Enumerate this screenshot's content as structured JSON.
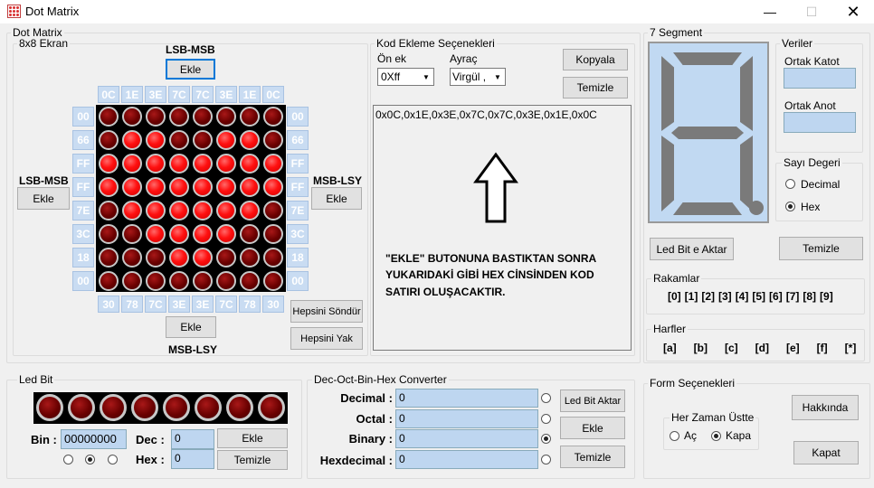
{
  "window": {
    "title": "Dot Matrix"
  },
  "dotmatrix": {
    "group_title": "Dot Matrix",
    "screen_title": "8x8 Ekran",
    "top_label": "LSB-MSB",
    "top_button": "Ekle",
    "left_label": "LSB-MSB",
    "left_button": "Ekle",
    "right_label": "MSB-LSY",
    "right_button": "Ekle",
    "bottom_button": "Ekle",
    "bottom_label": "MSB-LSY",
    "top_codes": [
      "0C",
      "1E",
      "3E",
      "7C",
      "7C",
      "3E",
      "1E",
      "0C"
    ],
    "left_codes": [
      "00",
      "66",
      "FF",
      "FF",
      "7E",
      "3C",
      "18",
      "00"
    ],
    "right_codes": [
      "00",
      "66",
      "FF",
      "FF",
      "7E",
      "3C",
      "18",
      "00"
    ],
    "bottom_codes": [
      "30",
      "78",
      "7C",
      "3E",
      "3E",
      "7C",
      "78",
      "30"
    ],
    "rows": [
      [
        0,
        0,
        0,
        0,
        0,
        0,
        0,
        0
      ],
      [
        0,
        1,
        1,
        0,
        0,
        1,
        1,
        0
      ],
      [
        1,
        1,
        1,
        1,
        1,
        1,
        1,
        1
      ],
      [
        1,
        1,
        1,
        1,
        1,
        1,
        1,
        1
      ],
      [
        0,
        1,
        1,
        1,
        1,
        1,
        1,
        0
      ],
      [
        0,
        0,
        1,
        1,
        1,
        1,
        0,
        0
      ],
      [
        0,
        0,
        0,
        1,
        1,
        0,
        0,
        0
      ],
      [
        0,
        0,
        0,
        0,
        0,
        0,
        0,
        0
      ]
    ],
    "btn_off_all": "Hepsini Söndür",
    "btn_on_all": "Hepsini Yak"
  },
  "code": {
    "group_title": "Kod Ekleme Seçenekleri",
    "prefix_label": "Ön ek",
    "prefix_value": "0Xff",
    "sep_label": "Ayraç",
    "sep_value": "Virgül ,",
    "copy_button": "Kopyala",
    "clear_button": "Temizle",
    "output": "0x0C,0x1E,0x3E,0x7C,0x7C,0x3E,0x1E,0x0C",
    "note_line1": "\"EKLE\" BUTONUNA BASTIKTAN SONRA",
    "note_line2": "YUKARIDAKİ GİBİ HEX CİNSİNDEN KOD",
    "note_line3": "SATIRI OLUŞACAKTIR."
  },
  "segment": {
    "group_title": "7 Segment",
    "data_title": "Veriler",
    "common_cathode": "Ortak Katot",
    "common_anode": "Ortak Anot",
    "value_title": "Sayı Degeri",
    "decimal": "Decimal",
    "hex": "Hex",
    "send_button": "Led Bit e Aktar",
    "clear_button": "Temizle",
    "digits_title": "Rakamlar",
    "digits": [
      "[0]",
      "[1]",
      "[2]",
      "[3]",
      "[4]",
      "[5]",
      "[6]",
      "[7]",
      "[8]",
      "[9]"
    ],
    "letters_title": "Harfler",
    "letters": [
      "[a]",
      "[b]",
      "[c]",
      "[d]",
      "[e]",
      "[f]",
      "[*]"
    ]
  },
  "ledbit": {
    "group_title": "Led Bit",
    "bin_label": "Bin :",
    "bin_value": "00000000",
    "dec_label": "Dec :",
    "dec_value": "0",
    "hex_label": "Hex :",
    "hex_value": "0",
    "add_button": "Ekle",
    "clear_button": "Temizle"
  },
  "converter": {
    "group_title": "Dec-Oct-Bin-Hex Converter",
    "decimal_label": "Decimal :",
    "decimal_value": "0",
    "octal_label": "Octal :",
    "octal_value": "0",
    "binary_label": "Binary :",
    "binary_value": "0",
    "hex_label": "Hexdecimal :",
    "hex_value": "0",
    "send_button": "Led Bit Aktar",
    "add_button": "Ekle",
    "clear_button": "Temizle"
  },
  "form": {
    "group_title": "Form Seçenekleri",
    "topmost_title": "Her Zaman Üstte",
    "on_label": "Aç",
    "off_label": "Kapa",
    "about_button": "Hakkında",
    "close_button": "Kapat"
  },
  "colors": {
    "led_on": "#ff1010",
    "led_off": "#6a0000",
    "hex_cell": "#c9dcf2"
  }
}
